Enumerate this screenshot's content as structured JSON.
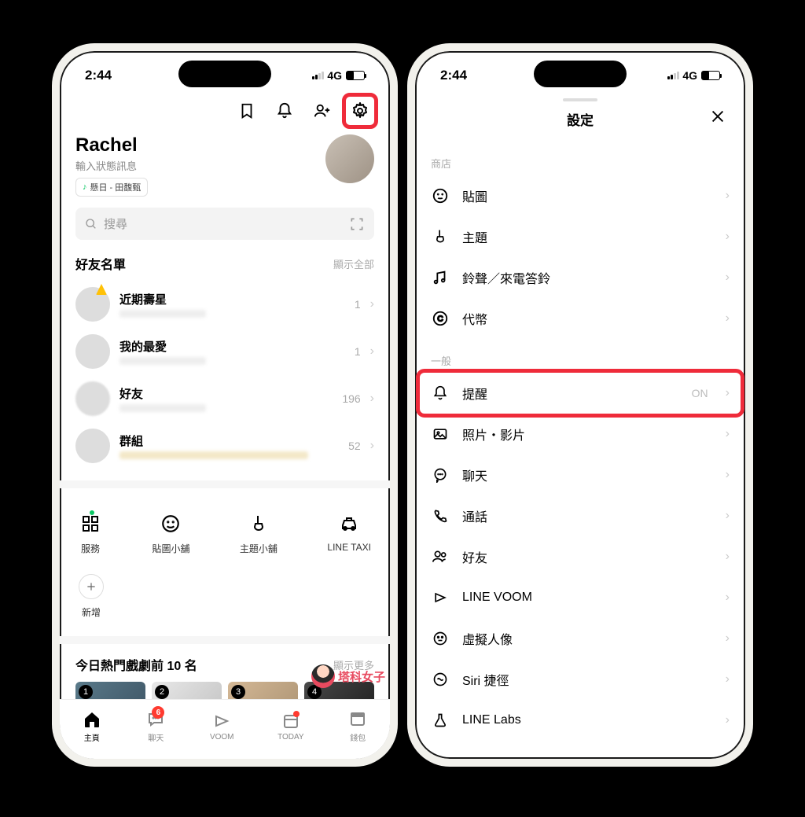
{
  "status": {
    "time": "2:44",
    "net": "4G"
  },
  "phone1": {
    "profile_name": "Rachel",
    "profile_sub": "輸入狀態訊息",
    "music": "懸日 - 田馥甄",
    "search_placeholder": "搜尋",
    "friends_header": "好友名單",
    "friends_more": "顯示全部",
    "friends": [
      {
        "name": "近期壽星",
        "count": "1"
      },
      {
        "name": "我的最愛",
        "count": "1"
      },
      {
        "name": "好友",
        "count": "196"
      },
      {
        "name": "群組",
        "count": "52"
      }
    ],
    "quick": [
      {
        "label": "服務"
      },
      {
        "label": "貼圖小舖"
      },
      {
        "label": "主題小舖"
      },
      {
        "label": "LINE TAXI"
      },
      {
        "label": "新增"
      }
    ],
    "drama_header": "今日熱門戲劇前 10 名",
    "drama_more": "顯示更多",
    "drama_nums": [
      "1",
      "2",
      "3",
      "4"
    ],
    "tabs": [
      {
        "label": "主頁"
      },
      {
        "label": "聊天",
        "badge": "6"
      },
      {
        "label": "VOOM"
      },
      {
        "label": "TODAY"
      },
      {
        "label": "錢包"
      }
    ]
  },
  "phone2": {
    "title": "設定",
    "group_shop": "商店",
    "group_general": "一般",
    "shop_rows": [
      {
        "label": "貼圖"
      },
      {
        "label": "主題"
      },
      {
        "label": "鈴聲／來電答鈴"
      },
      {
        "label": "代幣"
      }
    ],
    "general_rows": [
      {
        "label": "提醒",
        "value": "ON"
      },
      {
        "label": "照片・影片"
      },
      {
        "label": "聊天"
      },
      {
        "label": "通話"
      },
      {
        "label": "好友"
      },
      {
        "label": "LINE VOOM"
      },
      {
        "label": "虛擬人像"
      },
      {
        "label": "Siri 捷徑"
      },
      {
        "label": "LINE Labs"
      }
    ]
  },
  "watermark": "塔科女子"
}
